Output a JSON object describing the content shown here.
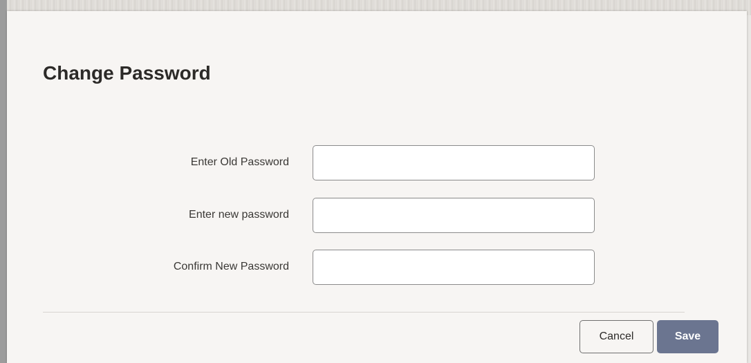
{
  "dialog": {
    "title": "Change Password",
    "fields": [
      {
        "label": "Enter Old Password",
        "value": "",
        "placeholder": ""
      },
      {
        "label": "Enter new password",
        "value": "",
        "placeholder": ""
      },
      {
        "label": "Confirm New Password",
        "value": "",
        "placeholder": ""
      }
    ],
    "buttons": {
      "cancel_label": "Cancel",
      "save_label": "Save"
    }
  },
  "colors": {
    "save_button_bg": "#6b7590",
    "dialog_bg": "#f7f5f3"
  }
}
